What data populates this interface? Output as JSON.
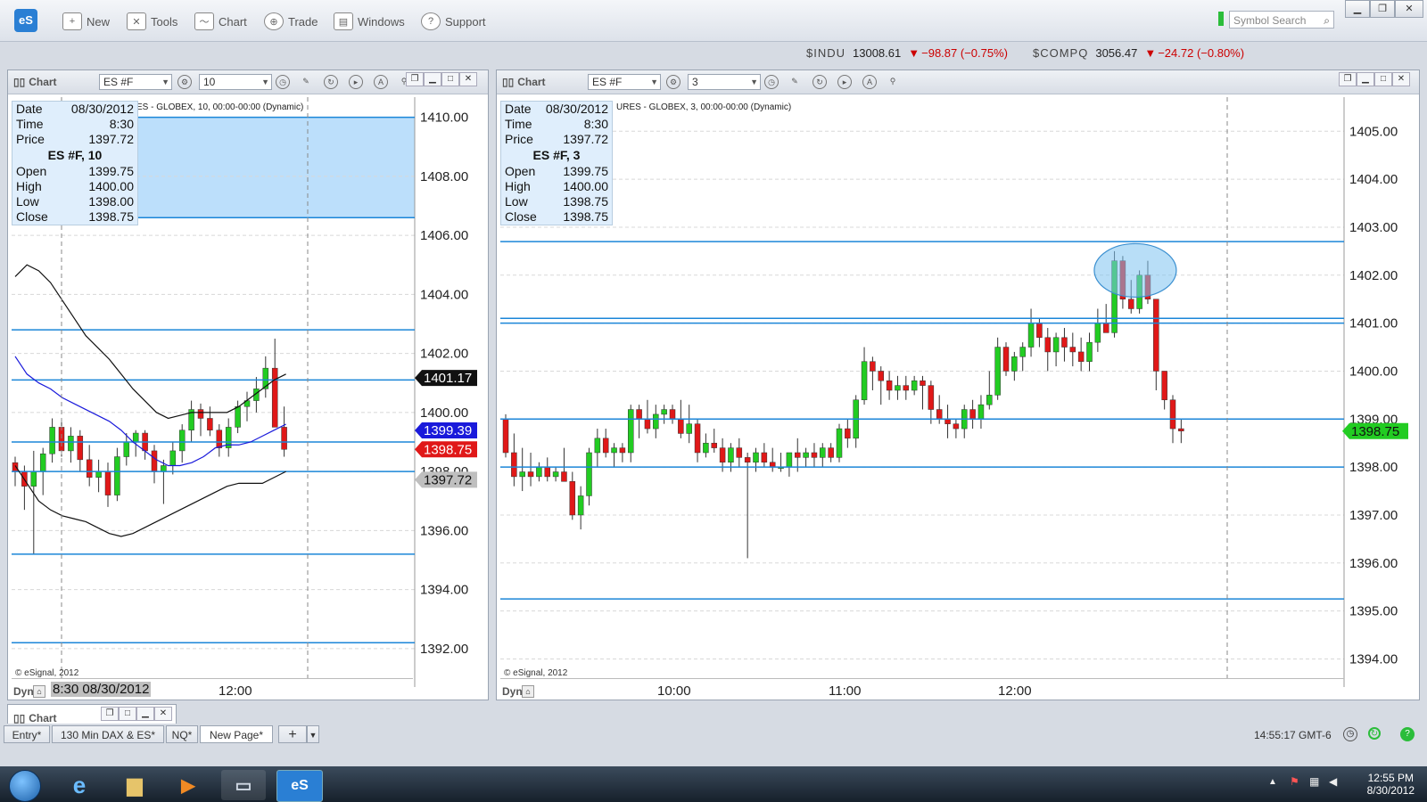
{
  "app": {
    "logo": "eS"
  },
  "toolbar": {
    "items": [
      {
        "label": "New",
        "icon": "new-window-icon"
      },
      {
        "label": "Tools",
        "icon": "tools-icon"
      },
      {
        "label": "Chart",
        "icon": "chart-icon"
      },
      {
        "label": "Trade",
        "icon": "trade-icon"
      },
      {
        "label": "Windows",
        "icon": "windows-icon"
      },
      {
        "label": "Support",
        "icon": "help-icon"
      }
    ],
    "search_placeholder": "Symbol Search"
  },
  "ticker": [
    {
      "symbol": "$INDU",
      "price": "13008.61",
      "change": "−98.87 (−0.75%)"
    },
    {
      "symbol": "$COMPQ",
      "price": "3056.47",
      "change": "−24.72 (−0.80%)"
    }
  ],
  "colors": {
    "up": "#22cc22",
    "down": "#e01818",
    "line": "#1b86d8",
    "zone": "#b5dcfb",
    "bid": "#1a1adb"
  },
  "left_chart": {
    "title": "Chart",
    "symbol": "ES #F",
    "interval": "10",
    "caption": "ES - GLOBEX, 10, 00:00-00:00 (Dynamic)",
    "info": {
      "date_label": "Date",
      "date": "08/30/2012",
      "time_label": "Time",
      "time": "8:30",
      "price_label": "Price",
      "price": "1397.72",
      "header": "ES #F, 10",
      "open_label": "Open",
      "open": "1399.75",
      "high_label": "High",
      "high": "1400.00",
      "low_label": "Low",
      "low": "1398.00",
      "close_label": "Close",
      "close": "1398.75"
    },
    "price_axis": [
      "1410.00",
      "1408.00",
      "1406.00",
      "1404.00",
      "1402.00",
      "1400.00",
      "1398.00",
      "1396.00",
      "1394.00",
      "1392.00"
    ],
    "markers": [
      {
        "label": "1401.17",
        "bg": "#111111",
        "fg": "#ffffff"
      },
      {
        "label": "1399.39",
        "bg": "#1a1adb",
        "fg": "#ffffff"
      },
      {
        "label": "1398.75",
        "bg": "#e01818",
        "fg": "#ffffff"
      },
      {
        "label": "1397.72",
        "bg": "#bfbfbf",
        "fg": "#111111"
      }
    ],
    "copyright": "© eSignal, 2012",
    "dyn": "Dyn",
    "x_cursor_label": "8:30 08/30/2012",
    "x_labels": [
      "12:00"
    ]
  },
  "right_chart": {
    "title": "Chart",
    "symbol": "ES #F",
    "interval": "3",
    "caption": "URES - GLOBEX, 3, 00:00-00:00 (Dynamic)",
    "info": {
      "date_label": "Date",
      "date": "08/30/2012",
      "time_label": "Time",
      "time": "8:30",
      "price_label": "Price",
      "price": "1397.72",
      "header": "ES #F, 3",
      "open_label": "Open",
      "open": "1399.75",
      "high_label": "High",
      "high": "1400.00",
      "low_label": "Low",
      "low": "1398.75",
      "close_label": "Close",
      "close": "1398.75"
    },
    "price_axis": [
      "1405.00",
      "1404.00",
      "1403.00",
      "1402.00",
      "1401.00",
      "1400.00",
      "1399.00",
      "1398.00",
      "1397.00",
      "1396.00",
      "1395.00",
      "1394.00"
    ],
    "last_marker": "1398.75",
    "copyright": "© eSignal, 2012",
    "dyn": "Dyn",
    "x_labels": [
      "10:00",
      "11:00",
      "12:00"
    ]
  },
  "mini_chart": {
    "title": "Chart"
  },
  "tabs": [
    "Entry*",
    "130 Min DAX & ES*",
    "NQ*",
    "New Page*"
  ],
  "status_time": "14:55:17 GMT-6",
  "taskbar": {
    "time": "12:55 PM",
    "date": "8/30/2012"
  },
  "chart_data": [
    {
      "type": "candlestick",
      "symbol": "ES #F",
      "interval": "10",
      "ylim": [
        1391,
        1410.5
      ],
      "ohlc": [
        [
          1398.3,
          1398.5,
          1397.5,
          1398.0
        ],
        [
          1398.0,
          1398.2,
          1396.7,
          1397.5
        ],
        [
          1397.5,
          1398.7,
          1395.2,
          1398.0
        ],
        [
          1398.0,
          1398.8,
          1397.2,
          1398.6
        ],
        [
          1398.6,
          1399.8,
          1398.3,
          1399.5
        ],
        [
          1399.5,
          1399.8,
          1398.5,
          1398.7
        ],
        [
          1398.7,
          1399.5,
          1398.3,
          1399.2
        ],
        [
          1399.2,
          1399.4,
          1398.0,
          1398.4
        ],
        [
          1398.4,
          1398.9,
          1397.5,
          1397.8
        ],
        [
          1397.8,
          1398.4,
          1397.3,
          1398.0
        ],
        [
          1398.0,
          1398.3,
          1396.8,
          1397.2
        ],
        [
          1397.2,
          1398.8,
          1397.0,
          1398.5
        ],
        [
          1398.5,
          1399.3,
          1398.2,
          1399.0
        ],
        [
          1399.0,
          1399.4,
          1398.5,
          1399.3
        ],
        [
          1399.3,
          1399.4,
          1398.4,
          1398.7
        ],
        [
          1398.7,
          1398.9,
          1397.6,
          1398.0
        ],
        [
          1398.0,
          1398.4,
          1396.9,
          1398.2
        ],
        [
          1398.2,
          1399.0,
          1397.9,
          1398.7
        ],
        [
          1398.7,
          1399.6,
          1398.3,
          1399.4
        ],
        [
          1399.4,
          1400.4,
          1399.0,
          1400.1
        ],
        [
          1400.1,
          1400.3,
          1399.2,
          1399.8
        ],
        [
          1399.8,
          1400.2,
          1399.2,
          1399.4
        ],
        [
          1399.4,
          1399.6,
          1398.5,
          1398.8
        ],
        [
          1398.8,
          1399.8,
          1398.5,
          1399.5
        ],
        [
          1399.5,
          1400.4,
          1399.3,
          1400.2
        ],
        [
          1400.2,
          1400.7,
          1399.7,
          1400.4
        ],
        [
          1400.4,
          1401.2,
          1400.0,
          1400.8
        ],
        [
          1400.8,
          1401.9,
          1400.5,
          1401.5
        ],
        [
          1401.5,
          1402.5,
          1401.0,
          1399.5
        ],
        [
          1399.5,
          1400.2,
          1398.5,
          1398.75
        ]
      ]
    },
    {
      "type": "candlestick",
      "symbol": "ES #F",
      "interval": "3",
      "ylim": [
        1393.6,
        1405.6
      ],
      "x_ticks": [
        "10:00",
        "11:00",
        "12:00"
      ],
      "ohlc": [
        [
          1399.0,
          1399.1,
          1398.2,
          1398.3
        ],
        [
          1398.3,
          1398.7,
          1397.6,
          1397.8
        ],
        [
          1397.8,
          1398.4,
          1397.5,
          1397.9
        ],
        [
          1397.9,
          1398.3,
          1397.6,
          1397.8
        ],
        [
          1397.8,
          1398.1,
          1397.7,
          1398.0
        ],
        [
          1398.0,
          1398.2,
          1397.7,
          1397.8
        ],
        [
          1397.8,
          1398.0,
          1397.7,
          1397.9
        ],
        [
          1397.9,
          1398.4,
          1397.7,
          1397.7
        ],
        [
          1397.7,
          1397.9,
          1396.9,
          1397.0
        ],
        [
          1397.0,
          1397.6,
          1396.7,
          1397.4
        ],
        [
          1397.4,
          1398.4,
          1397.2,
          1398.3
        ],
        [
          1398.3,
          1398.8,
          1398.0,
          1398.6
        ],
        [
          1398.6,
          1398.8,
          1398.2,
          1398.3
        ],
        [
          1398.3,
          1398.5,
          1398.0,
          1398.4
        ],
        [
          1398.4,
          1398.5,
          1398.1,
          1398.3
        ],
        [
          1398.3,
          1399.3,
          1398.1,
          1399.2
        ],
        [
          1399.2,
          1399.3,
          1398.6,
          1399.0
        ],
        [
          1399.0,
          1399.4,
          1398.7,
          1398.8
        ],
        [
          1398.8,
          1399.3,
          1398.6,
          1399.1
        ],
        [
          1399.1,
          1399.3,
          1398.9,
          1399.2
        ],
        [
          1399.2,
          1399.3,
          1398.9,
          1399.0
        ],
        [
          1399.0,
          1399.4,
          1398.6,
          1398.7
        ],
        [
          1398.7,
          1399.3,
          1398.5,
          1398.9
        ],
        [
          1398.9,
          1399.0,
          1398.1,
          1398.3
        ],
        [
          1398.3,
          1398.7,
          1398.2,
          1398.5
        ],
        [
          1398.5,
          1398.8,
          1398.3,
          1398.4
        ],
        [
          1398.4,
          1398.6,
          1397.9,
          1398.1
        ],
        [
          1398.1,
          1398.5,
          1397.9,
          1398.4
        ],
        [
          1398.4,
          1398.6,
          1398.0,
          1398.2
        ],
        [
          1398.2,
          1398.3,
          1396.1,
          1398.1
        ],
        [
          1398.1,
          1398.4,
          1397.9,
          1398.3
        ],
        [
          1398.3,
          1398.5,
          1398.0,
          1398.1
        ],
        [
          1398.1,
          1398.4,
          1397.9,
          1398.0
        ],
        [
          1398.0,
          1398.3,
          1397.9,
          1398.0
        ],
        [
          1398.0,
          1398.3,
          1397.8,
          1398.3
        ],
        [
          1398.3,
          1398.6,
          1397.9,
          1398.2
        ],
        [
          1398.2,
          1398.4,
          1398.0,
          1398.3
        ],
        [
          1398.3,
          1398.5,
          1398.0,
          1398.2
        ],
        [
          1398.2,
          1398.5,
          1398.0,
          1398.4
        ],
        [
          1398.4,
          1398.5,
          1398.1,
          1398.2
        ],
        [
          1398.2,
          1398.9,
          1398.1,
          1398.8
        ],
        [
          1398.8,
          1399.0,
          1398.4,
          1398.6
        ],
        [
          1398.6,
          1399.5,
          1398.4,
          1399.4
        ],
        [
          1399.4,
          1400.5,
          1399.3,
          1400.2
        ],
        [
          1400.2,
          1400.3,
          1399.6,
          1400.0
        ],
        [
          1400.0,
          1400.1,
          1399.3,
          1399.8
        ],
        [
          1399.8,
          1400.0,
          1399.4,
          1399.6
        ],
        [
          1399.6,
          1399.9,
          1399.4,
          1399.7
        ],
        [
          1399.7,
          1399.9,
          1399.4,
          1399.6
        ],
        [
          1399.6,
          1399.9,
          1399.5,
          1399.8
        ],
        [
          1399.8,
          1399.9,
          1399.2,
          1399.7
        ],
        [
          1399.7,
          1399.8,
          1398.9,
          1399.2
        ],
        [
          1399.2,
          1399.5,
          1398.9,
          1399.0
        ],
        [
          1399.0,
          1399.3,
          1398.6,
          1398.9
        ],
        [
          1398.9,
          1399.0,
          1398.6,
          1398.8
        ],
        [
          1398.8,
          1399.3,
          1398.6,
          1399.2
        ],
        [
          1399.2,
          1399.4,
          1398.8,
          1399.0
        ],
        [
          1399.0,
          1399.5,
          1398.8,
          1399.3
        ],
        [
          1399.3,
          1400.0,
          1399.2,
          1399.5
        ],
        [
          1399.5,
          1400.7,
          1399.4,
          1400.5
        ],
        [
          1400.5,
          1400.6,
          1399.9,
          1400.0
        ],
        [
          1400.0,
          1400.4,
          1399.8,
          1400.3
        ],
        [
          1400.3,
          1400.6,
          1400.0,
          1400.5
        ],
        [
          1400.5,
          1401.3,
          1400.3,
          1401.0
        ],
        [
          1401.0,
          1401.1,
          1400.5,
          1400.7
        ],
        [
          1400.7,
          1400.9,
          1400.0,
          1400.4
        ],
        [
          1400.4,
          1400.8,
          1400.1,
          1400.7
        ],
        [
          1400.7,
          1400.9,
          1400.2,
          1400.5
        ],
        [
          1400.5,
          1400.8,
          1400.1,
          1400.4
        ],
        [
          1400.4,
          1400.7,
          1400.0,
          1400.2
        ],
        [
          1400.2,
          1400.8,
          1400.0,
          1400.6
        ],
        [
          1400.6,
          1401.3,
          1400.4,
          1401.0
        ],
        [
          1401.0,
          1401.4,
          1400.9,
          1400.8
        ],
        [
          1400.8,
          1402.5,
          1400.7,
          1402.3
        ],
        [
          1402.3,
          1402.4,
          1401.3,
          1401.5
        ],
        [
          1401.5,
          1401.9,
          1401.2,
          1401.3
        ],
        [
          1401.3,
          1402.1,
          1401.2,
          1402.0
        ],
        [
          1402.0,
          1402.3,
          1401.4,
          1401.5
        ],
        [
          1401.5,
          1401.5,
          1399.6,
          1400.0
        ],
        [
          1400.0,
          1400.0,
          1399.2,
          1399.4
        ],
        [
          1399.4,
          1399.5,
          1398.5,
          1398.8
        ],
        [
          1398.8,
          1399.0,
          1398.5,
          1398.75
        ]
      ]
    }
  ]
}
